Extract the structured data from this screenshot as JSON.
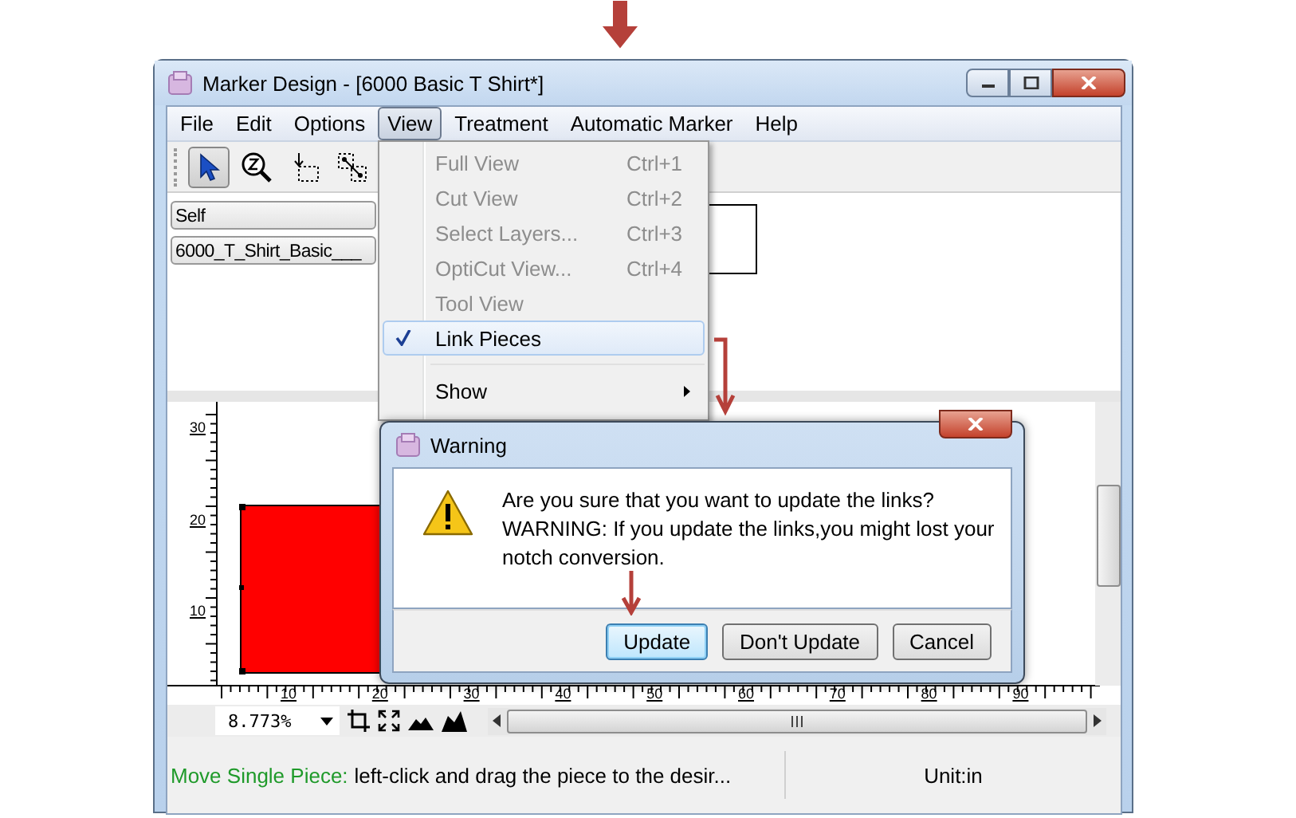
{
  "window": {
    "title": "Marker Design - [6000 Basic T Shirt*]"
  },
  "menubar": [
    {
      "label": "File",
      "selected": false
    },
    {
      "label": "Edit",
      "selected": false
    },
    {
      "label": "Options",
      "selected": false
    },
    {
      "label": "View",
      "selected": true
    },
    {
      "label": "Treatment",
      "selected": false
    },
    {
      "label": "Automatic Marker",
      "selected": false
    },
    {
      "label": "Help",
      "selected": false
    }
  ],
  "toolbar": [
    {
      "kind": "pointer",
      "selected": true
    },
    {
      "kind": "zoom",
      "selected": false
    },
    {
      "kind": "place",
      "selected": false
    },
    {
      "kind": "link",
      "selected": false
    }
  ],
  "selectors": [
    {
      "value": "Self"
    },
    {
      "value": "6000_T_Shirt_Basic___"
    }
  ],
  "view_menu": [
    {
      "kind": "item",
      "label": "Full View",
      "shortcut": "Ctrl+1",
      "disabled": true,
      "checked": false,
      "selected": false
    },
    {
      "kind": "item",
      "label": "Cut View",
      "shortcut": "Ctrl+2",
      "disabled": true,
      "checked": false,
      "selected": false
    },
    {
      "kind": "item",
      "label": "Select Layers...",
      "shortcut": "Ctrl+3",
      "disabled": true,
      "checked": false,
      "selected": false
    },
    {
      "kind": "item",
      "label": "OptiCut View...",
      "shortcut": "Ctrl+4",
      "disabled": true,
      "checked": false,
      "selected": false
    },
    {
      "kind": "item",
      "label": "Tool View",
      "disabled": true,
      "checked": false,
      "selected": false
    },
    {
      "kind": "item",
      "label": "Link Pieces",
      "disabled": false,
      "checked": true,
      "selected": true
    },
    {
      "kind": "separator"
    },
    {
      "kind": "submenu",
      "label": "Show",
      "disabled": false,
      "checked": false,
      "selected": false
    }
  ],
  "canvas": {
    "y_ticks": [
      "30",
      "20",
      "10"
    ],
    "x_ticks": [
      "10",
      "20",
      "30",
      "40",
      "50",
      "60",
      "70",
      "80",
      "90"
    ]
  },
  "zoom": {
    "value": "8.773%"
  },
  "status": {
    "mode": "Move Single Piece:",
    "hint": "left-click and drag the piece to the desir...",
    "unit": "Unit:in"
  },
  "dialog": {
    "title": "Warning",
    "message": [
      "Are you sure that you want to update the links?",
      "WARNING: If you update the links,you might lost your",
      "notch conversion."
    ],
    "buttons": [
      {
        "label": "Update",
        "selected": true
      },
      {
        "label": "Don't Update",
        "selected": false
      },
      {
        "label": "Cancel",
        "selected": false
      }
    ]
  }
}
